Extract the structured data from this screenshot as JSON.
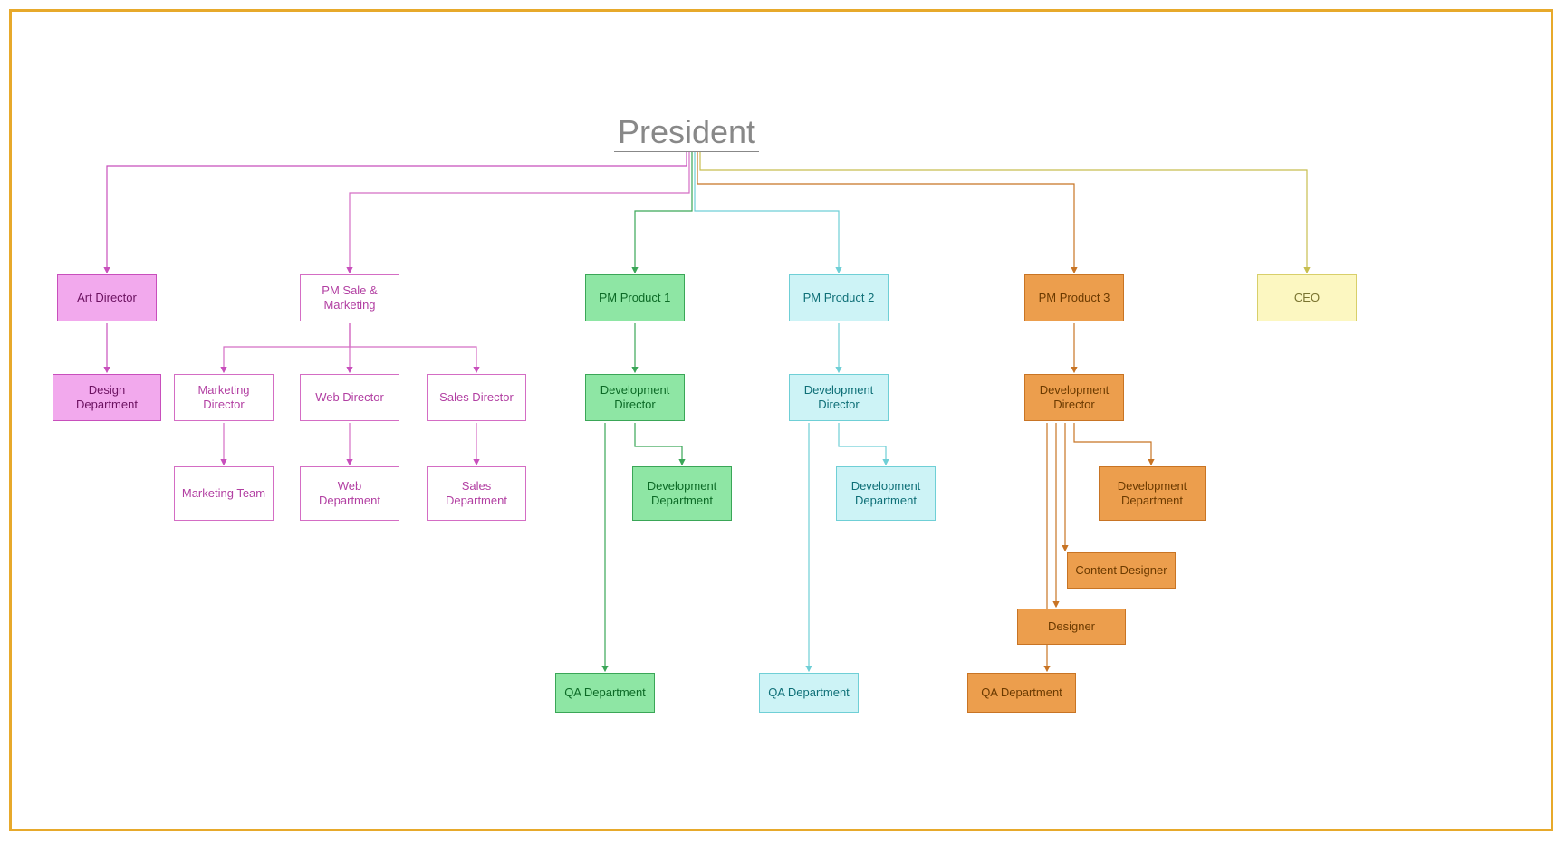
{
  "root": {
    "label": "President"
  },
  "row1": {
    "art_director": {
      "label": "Art Director"
    },
    "pm_sale_mkt": {
      "label": "PM Sale & Marketing"
    },
    "pm_product1": {
      "label": "PM Product 1"
    },
    "pm_product2": {
      "label": "PM Product 2"
    },
    "pm_product3": {
      "label": "PM Product 3"
    },
    "ceo": {
      "label": "CEO"
    }
  },
  "art_branch": {
    "design_dept": {
      "label": "Design Department"
    }
  },
  "salemkt_branch": {
    "marketing_director": {
      "label": "Marketing Director"
    },
    "web_director": {
      "label": "Web Director"
    },
    "sales_director": {
      "label": "Sales Director"
    },
    "marketing_team": {
      "label": "Marketing Team"
    },
    "web_department": {
      "label": "Web Department"
    },
    "sales_department": {
      "label": "Sales Department"
    }
  },
  "product1_branch": {
    "dev_director": {
      "label": "Development Director"
    },
    "dev_dept": {
      "label": "Development Department"
    },
    "qa_dept": {
      "label": "QA Department"
    }
  },
  "product2_branch": {
    "dev_director": {
      "label": "Development Director"
    },
    "dev_dept": {
      "label": "Development Department"
    },
    "qa_dept": {
      "label": "QA Department"
    }
  },
  "product3_branch": {
    "dev_director": {
      "label": "Development Director"
    },
    "dev_dept": {
      "label": "Development Department"
    },
    "content_designer": {
      "label": "Content Designer"
    },
    "designer": {
      "label": "Designer"
    },
    "qa_dept": {
      "label": "QA Department"
    }
  },
  "colors": {
    "frame_border": "#e7a92b",
    "pink": "#f2a9ed",
    "green": "#8ee6a4",
    "cyan": "#cdf3f6",
    "orange": "#ec9e4d",
    "yellow": "#fcf7c1"
  }
}
